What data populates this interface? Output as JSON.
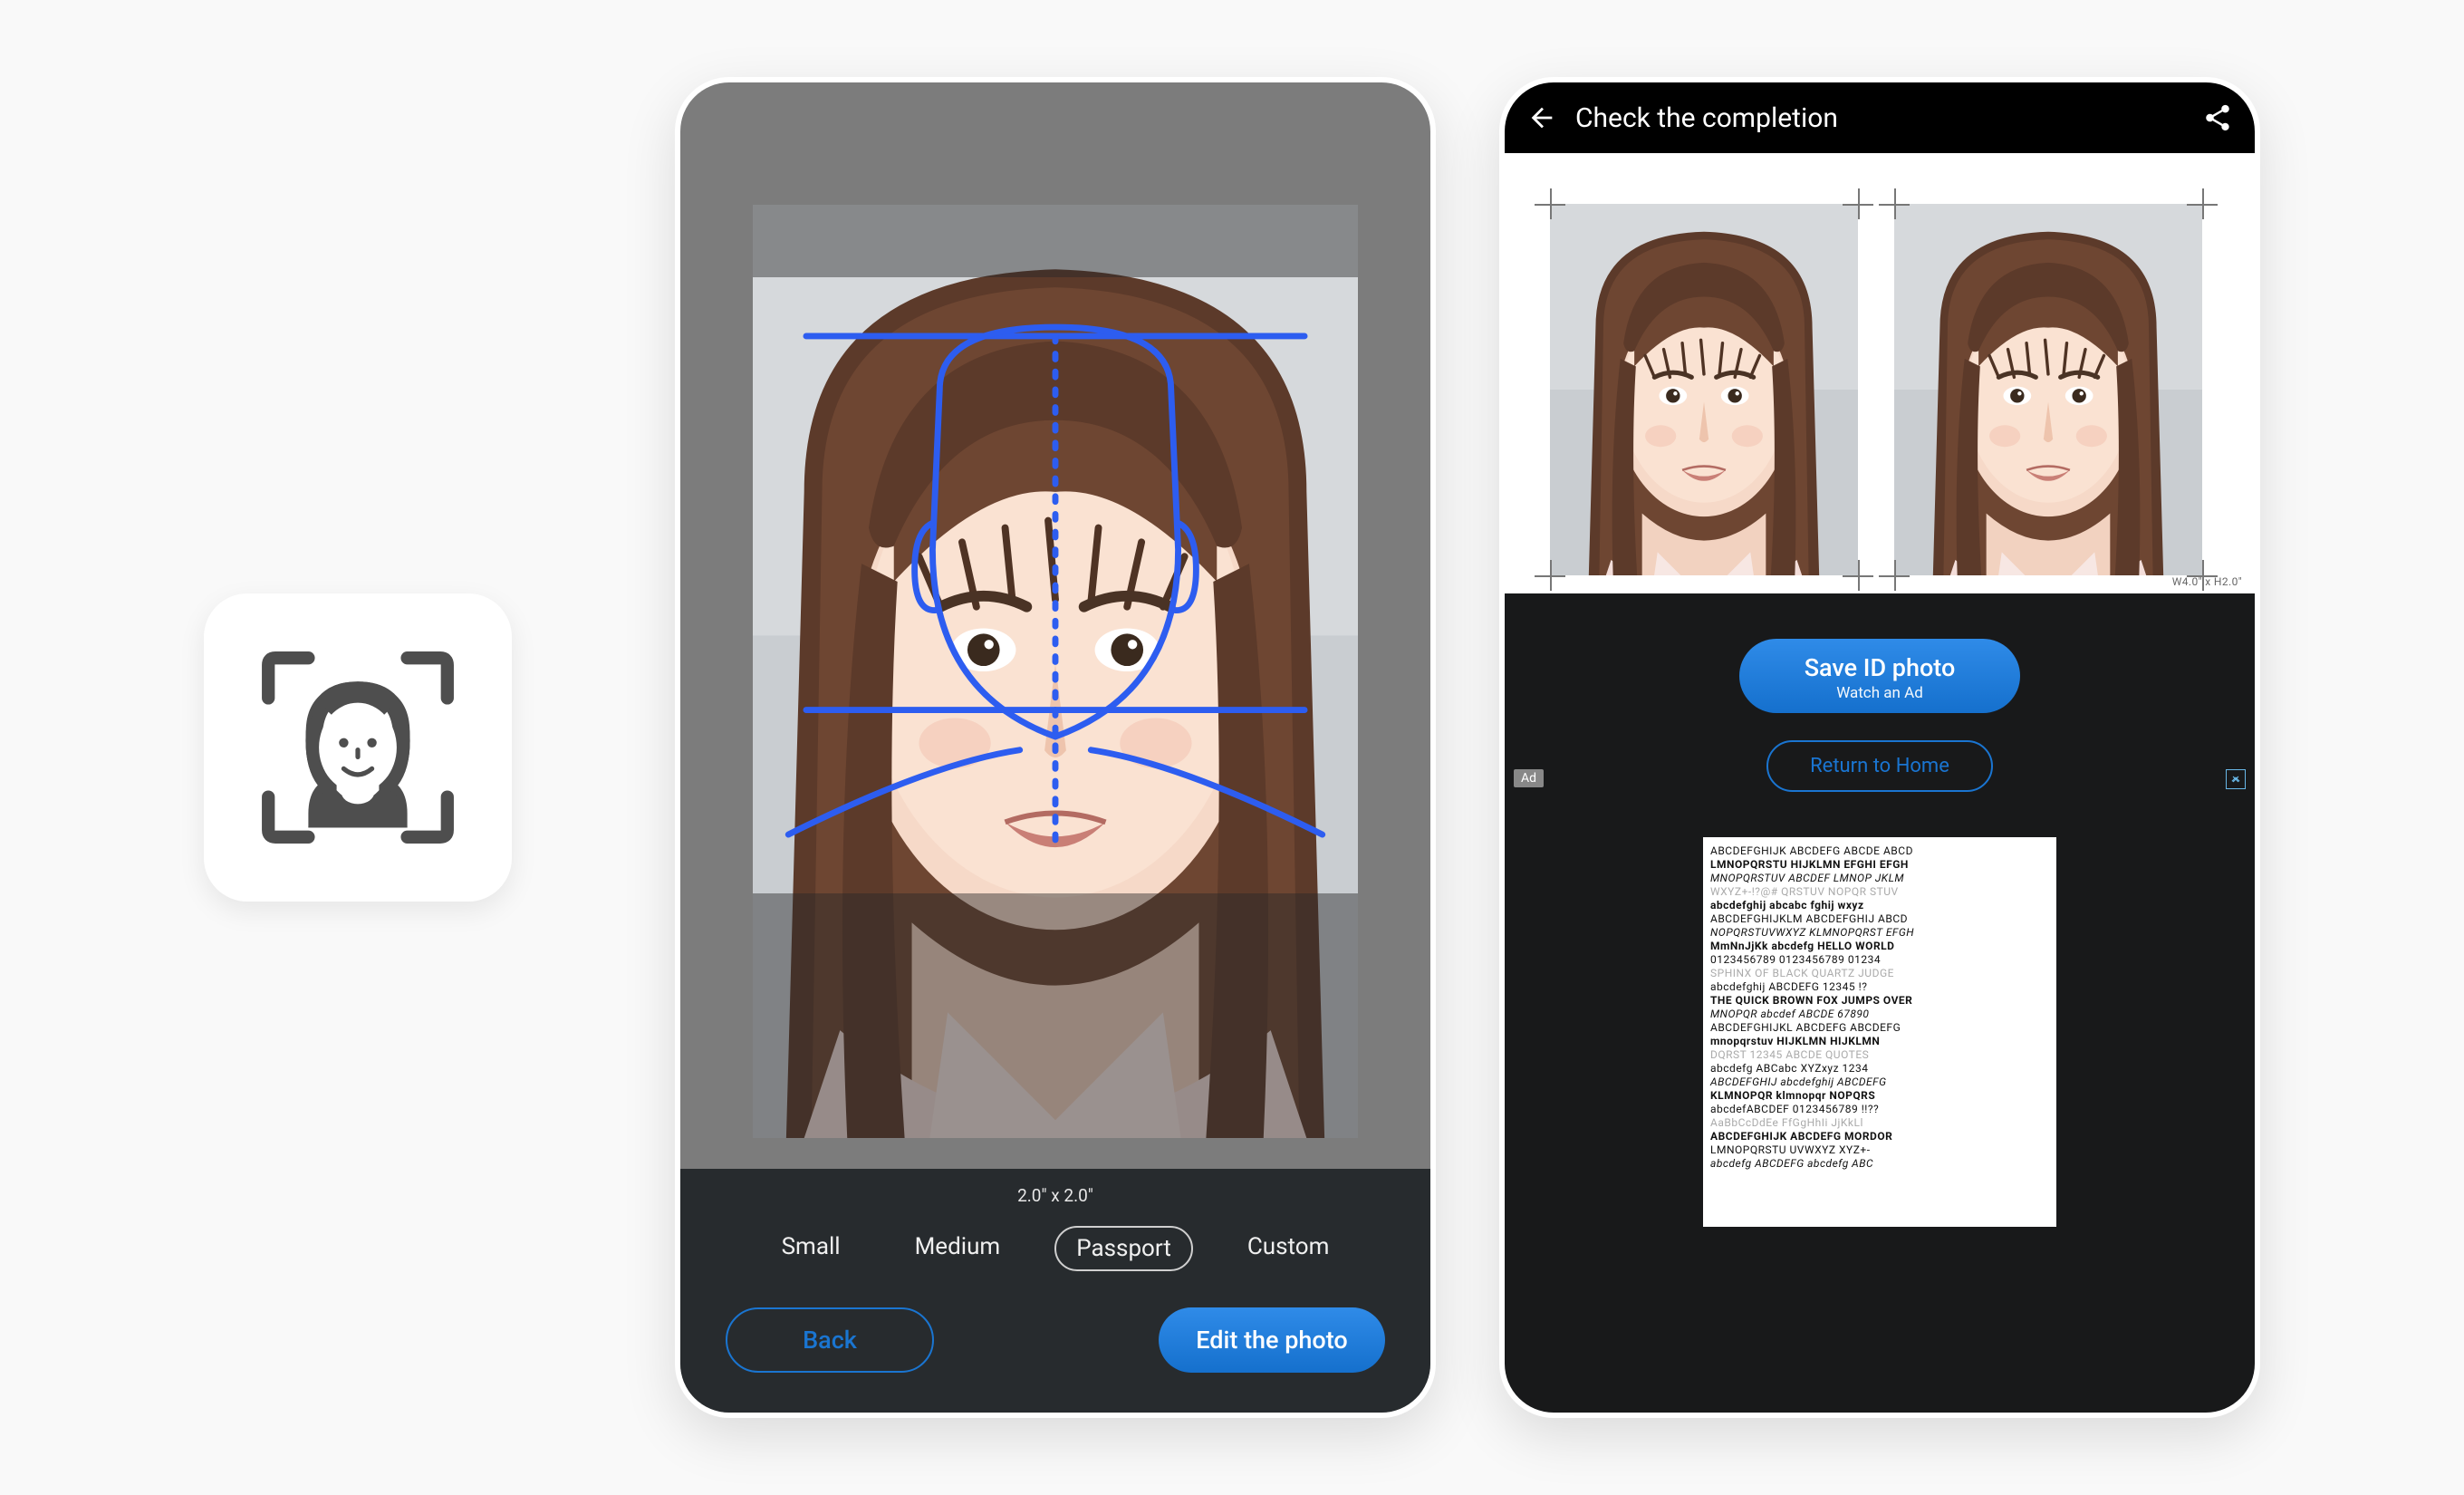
{
  "app_icon": {
    "name": "id-photo-app"
  },
  "editor": {
    "size_label": "2.0\" x 2.0\"",
    "options": [
      "Small",
      "Medium",
      "Passport",
      "Custom"
    ],
    "selected_index": 2,
    "back_label": "Back",
    "edit_label": "Edit the photo",
    "guide_color": "#2d5df0"
  },
  "completion": {
    "title": "Check the completion",
    "paper_label": "W4.0\" x H2.0\"",
    "save_label": "Save ID photo",
    "save_sub": "Watch an Ad",
    "return_label": "Return to Home",
    "ad_badge": "Ad",
    "ad_rows": [
      "ABCDEFGHIJK ABCDEFG ABCDE ABCD",
      "LMNOPQRSTU HIJKLMN EFGHI EFGH",
      "MNOPQRSTUV ABCDEF LMNOP JKLM",
      "WXYZ+-!?@# QRSTUV NOPQR STUV",
      "abcdefghij abcabc fghij wxyz",
      "ABCDEFGHIJKLM ABCDEFGHIJ ABCD",
      "NOPQRSTUVWXYZ KLMNOPQRST EFGH",
      "MmNnJjKk abcdefg HELLO WORLD",
      "0123456789 0123456789 01234",
      "SPHINX OF BLACK QUARTZ JUDGE",
      "abcdefghij ABCDEFG 12345 !?",
      "THE QUICK BROWN FOX JUMPS OVER",
      "MNOPQR abcdef ABCDE 67890",
      "ABCDEFGHIJKL ABCDEFG ABCDEFG",
      "mnopqrstuv HIJKLMN HIJKLMN",
      "DQRST 12345 ABCDE QUOTES",
      "abcdefg ABCabc XYZxyz 1234",
      "ABCDEFGHIJ abcdefghij ABCDEFG",
      "KLMNOPQR klmnopqr NOPQRS",
      "abcdefABCDEF 0123456789 !!??",
      "AaBbCcDdEe FfGgHhIi JjKkLl",
      "ABCDEFGHIJK ABCDEFG MORDOR",
      "LMNOPQRSTU UVWXYZ XYZ+-",
      "abcdefg ABCDEFG abcdefg ABC"
    ]
  }
}
